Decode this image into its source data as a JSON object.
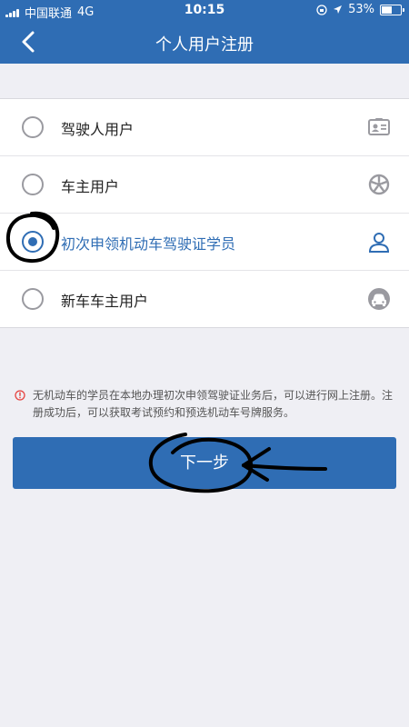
{
  "status_bar": {
    "carrier": "中国联通",
    "network": "4G",
    "time": "10:15",
    "battery": "53%"
  },
  "nav": {
    "title": "个人用户注册",
    "back_icon": "chevron-left-icon"
  },
  "options": [
    {
      "label": "驾驶人用户",
      "selected": false,
      "icon": "id-card-icon"
    },
    {
      "label": "车主用户",
      "selected": false,
      "icon": "wheel-icon"
    },
    {
      "label": "初次申领机动车驾驶证学员",
      "selected": true,
      "icon": "person-icon"
    },
    {
      "label": "新车车主用户",
      "selected": false,
      "icon": "car-icon"
    }
  ],
  "notice": {
    "text": "无机动车的学员在本地办理初次申领驾驶证业务后，可以进行网上注册。注册成功后，可以获取考试预约和预选机动车号牌服务。",
    "icon": "info-icon"
  },
  "next_button": {
    "label": "下一步"
  },
  "colors": {
    "brand": "#2f6db4",
    "background": "#efeff4",
    "notice_icon": "#e64340"
  }
}
